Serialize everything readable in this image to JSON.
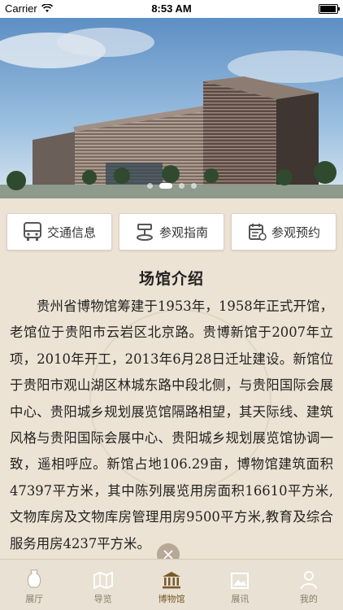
{
  "status_bar": {
    "carrier": "Carrier",
    "time": "8:53 AM"
  },
  "hero": {
    "slide_count": 4,
    "active_slide": 1
  },
  "quick_buttons": [
    {
      "label": "交通信息",
      "icon": "bus-icon"
    },
    {
      "label": "参观指南",
      "icon": "signpost-icon"
    },
    {
      "label": "参观预约",
      "icon": "calendar-icon"
    }
  ],
  "intro": {
    "title": "场馆介绍",
    "body": "贵州省博物馆筹建于1953年，1958年正式开馆，老馆位于贵阳市云岩区北京路。贵博新馆于2007年立项，2010年开工，2013年6月28日迁址建设。新馆位于贵阳市观山湖区林城东路中段北侧，与贵阳国际会展中心、贵阳城乡规划展览馆隔路相望，其天际线、建筑风格与贵阳国际会展中心、贵阳城乡规划展览馆协调一致，遥相呼应。新馆占地106.29亩，博物馆建筑面积47397平方米，其中陈列展览用房面积16610平方米,文物库房及文物库房管理用房9500平方米,教育及综合服务用房4237平方米。"
  },
  "tabbar": {
    "tabs": [
      {
        "label": "展厅",
        "icon": "vase-icon"
      },
      {
        "label": "导览",
        "icon": "map-icon"
      },
      {
        "label": "博物馆",
        "icon": "museum-icon"
      },
      {
        "label": "展讯",
        "icon": "image-icon"
      },
      {
        "label": "我的",
        "icon": "person-icon"
      }
    ],
    "active": "博物馆"
  }
}
